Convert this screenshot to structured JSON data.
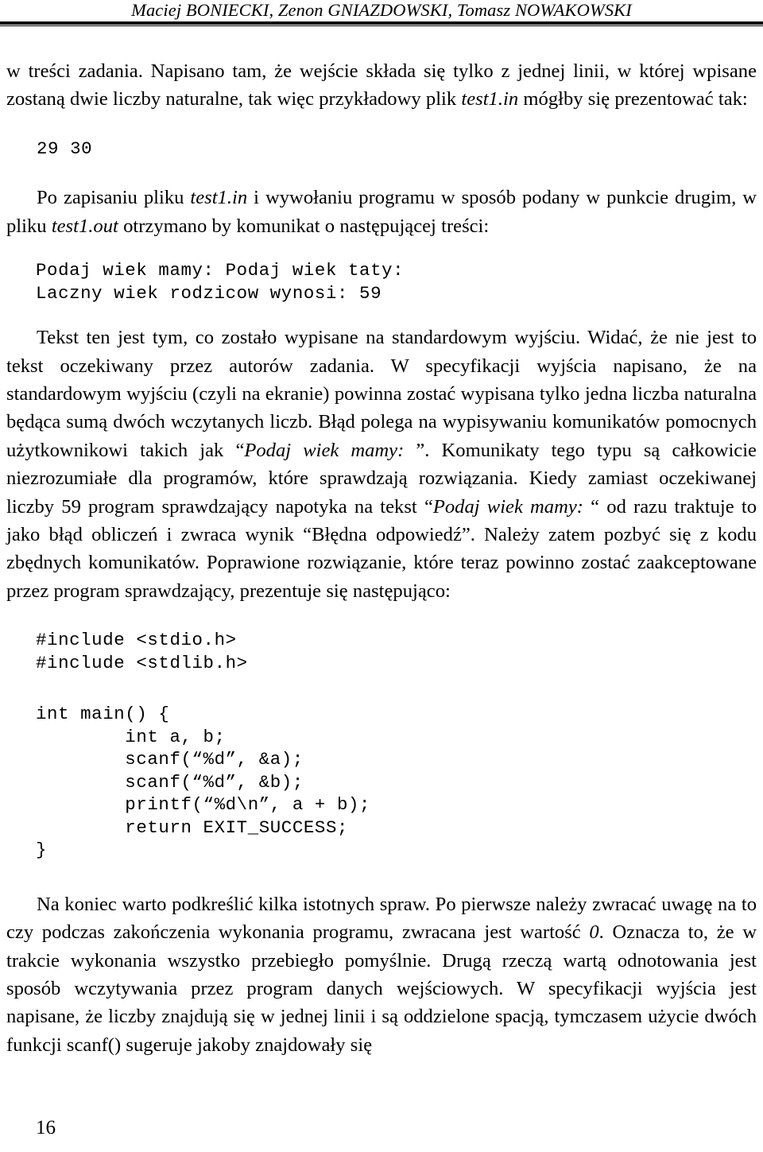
{
  "document": {
    "running_head": "Maciej BONIECKI, Zenon GNIAZDOWSKI, Tomasz NOWAKOWSKI",
    "page_number": "16"
  },
  "body": {
    "para_1": {
      "part_a": "w treści zadania. Napisano tam, że wejście składa się tylko z jednej linii, w której wpisane zostaną dwie liczby naturalne, tak więc przykładowy plik ",
      "file_1": "test1.in",
      "part_b": " mógłby się prezentować tak:"
    },
    "listing_input": "29 30",
    "para_2": {
      "part_a": "Po zapisaniu pliku ",
      "file_1": "test1.in",
      "part_b": " i wywołaniu programu w sposób podany w punkcie drugim, w pliku ",
      "file_2": "test1.out",
      "part_c": " otrzymano by komunikat o następującej treści:"
    },
    "listing_output": "Podaj wiek mamy: Podaj wiek taty:\nLaczny wiek rodzicow wynosi: 59",
    "para_3": {
      "part_a": "Tekst ten jest tym, co zostało wypisane na standardowym wyjściu. Widać, że nie jest to tekst oczekiwany przez autorów zadania. W specyfikacji wyjścia napisano, że na standardowym wyjściu (czyli na ekranie) powinna zostać wypisana tylko jedna liczba naturalna będąca sumą dwóch wczytanych liczb. Błąd polega na wypisywaniu komunikatów pomocnych użytkownikowi takich jak “",
      "quote_1": "Podaj wiek mamy: ",
      "part_b": "”. Komunikaty tego typu są całkowicie niezrozumiałe dla programów, które sprawdzają rozwiązania. Kiedy zamiast oczekiwanej liczby 59 program sprawdzający napotyka na tekst “",
      "quote_2": "Podaj wiek mamy: ",
      "part_c": "“ od razu traktuje to jako błąd obliczeń i zwraca wynik “Błędna odpowiedź”. Należy zatem pozbyć się z kodu zbędnych komunikatów. Poprawione rozwiązanie, które teraz powinno zostać zaakceptowane przez program sprawdzający, prezentuje się następująco:"
    },
    "listing_code_includes": "#include <stdio.h>\n#include <stdlib.h>",
    "listing_code_main": "int main() {\n        int a, b;\n        scanf(“%d”, &a);\n        scanf(“%d”, &b);\n        printf(“%d\\n”, a + b);\n        return EXIT_SUCCESS;\n}",
    "para_4": {
      "part_a": "Na koniec warto podkreślić kilka istotnych spraw. Po pierwsze należy zwracać uwagę na to czy podczas zakończenia wykonania programu, zwracana jest wartość ",
      "value_0": "0",
      "part_b": ". Oznacza to, że w trakcie wykonania wszystko przebiegło pomyślnie. Drugą rzeczą wartą odnotowania jest sposób wczytywania przez program danych wejściowych. W specyfikacji wyjścia jest napisane, że liczby znajdują się w jednej linii i są oddzielone spacją, tymczasem użycie dwóch funkcji scanf() sugeruje jakoby znajdowały się"
    }
  }
}
